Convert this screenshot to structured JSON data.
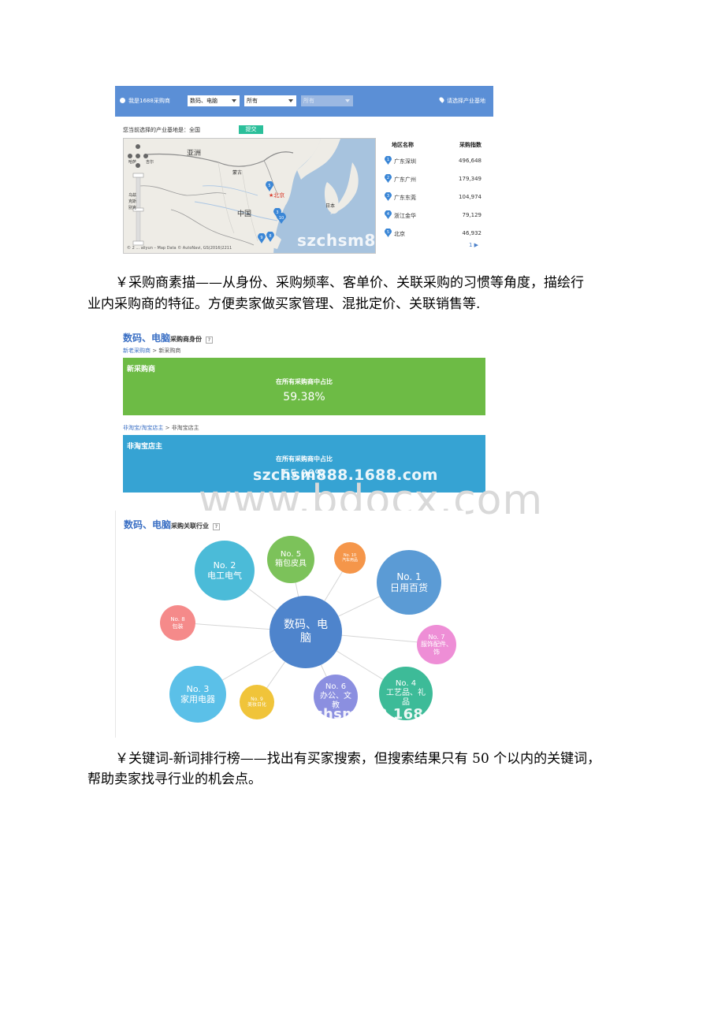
{
  "shot1": {
    "buyer_label": "我是1688采购商",
    "select_category": "数码、电脑",
    "select_sub": "所有",
    "select_third": "所有",
    "region_link": "请选择产业基地",
    "current_label": "您当前选择的产业基地是：全国",
    "submit_label": "提交",
    "map": {
      "labels": {
        "asia": "亚洲",
        "mongolia": "蒙古",
        "china": "中国",
        "beijing": "北京",
        "japan": "日本",
        "left1": "哈萨",
        "left2": "吉尔",
        "left3": "乌兹",
        "left4": "克斯",
        "left5": "别克"
      },
      "markers": [
        "5",
        "3",
        "10",
        "9",
        "8"
      ],
      "attribution": "© 2 ... aliyun – Map Data © AutoNavi, GS(2016)2211",
      "watermark": "szchsm88"
    },
    "rank_headers": {
      "region": "地区名称",
      "index": "采购指数"
    },
    "rank_rows": [
      {
        "no": "1",
        "region": "广东深圳",
        "value": "496,648"
      },
      {
        "no": "2",
        "region": "广东广州",
        "value": "179,349"
      },
      {
        "no": "3",
        "region": "广东东莞",
        "value": "104,974"
      },
      {
        "no": "4",
        "region": "浙江金华",
        "value": "79,129"
      },
      {
        "no": "5",
        "region": "北京",
        "value": "46,932"
      }
    ],
    "pager": "1 ▶"
  },
  "para1": {
    "line1": "￥采购商素描——从身份、采购频率、客单价、关联采购的习惯等角度，描绘行",
    "line2": "业内采购商的特征。方便卖家做买家管理、混批定价、关联销售等."
  },
  "shot2": {
    "title": "数码、电脑",
    "title_sub": "采购商身份",
    "help": "?",
    "crumb1": {
      "link": "新老采购商",
      "sep": " > ",
      "current": "新采购商"
    },
    "box1": {
      "name": "新采购商",
      "caption": "在所有采购商中占比",
      "value": "59.38%"
    },
    "crumb2": {
      "link": "非淘宝/淘宝店主",
      "sep": " > ",
      "current": "非淘宝店主"
    },
    "box2": {
      "name": "非淘宝店主",
      "caption": "在所有采购商中占比",
      "value": "55.00%"
    },
    "watermark": "szchsm888.1688.com"
  },
  "watermark_big": "www.bdocx.com",
  "shot3": {
    "title": "数码、电脑",
    "title_sub": "采购关联行业",
    "help": "?",
    "center": "数码、电脑",
    "bubbles": [
      {
        "no": "No. 1",
        "name": "日用百货",
        "color": "#5b9bd5"
      },
      {
        "no": "No. 2",
        "name": "电工电气",
        "color": "#4bbbd8"
      },
      {
        "no": "No. 3",
        "name": "家用电器",
        "color": "#5bc0e8"
      },
      {
        "no": "No. 4",
        "name": "工艺品、礼品",
        "color": "#3dbb98"
      },
      {
        "no": "No. 5",
        "name": "箱包皮具",
        "color": "#7cc25a"
      },
      {
        "no": "No. 6",
        "name": "办公、文教",
        "color": "#8b8fe0"
      },
      {
        "no": "No. 7",
        "name": "服饰配件、饰",
        "color": "#ee8ed6"
      },
      {
        "no": "No. 8",
        "name": "包装",
        "color": "#f58a8a"
      },
      {
        "no": "No. 9",
        "name": "美妆日化",
        "color": "#f0c43a"
      },
      {
        "no": "No. 10",
        "name": "汽车用品",
        "color": "#f5964a"
      }
    ],
    "watermark": "chsm888.168"
  },
  "para2": {
    "line1": "￥关键词-新词排行榜——找出有买家搜索，但搜索结果只有 50 个以内的关键词，",
    "line2": "帮助卖家找寻行业的机会点。"
  }
}
